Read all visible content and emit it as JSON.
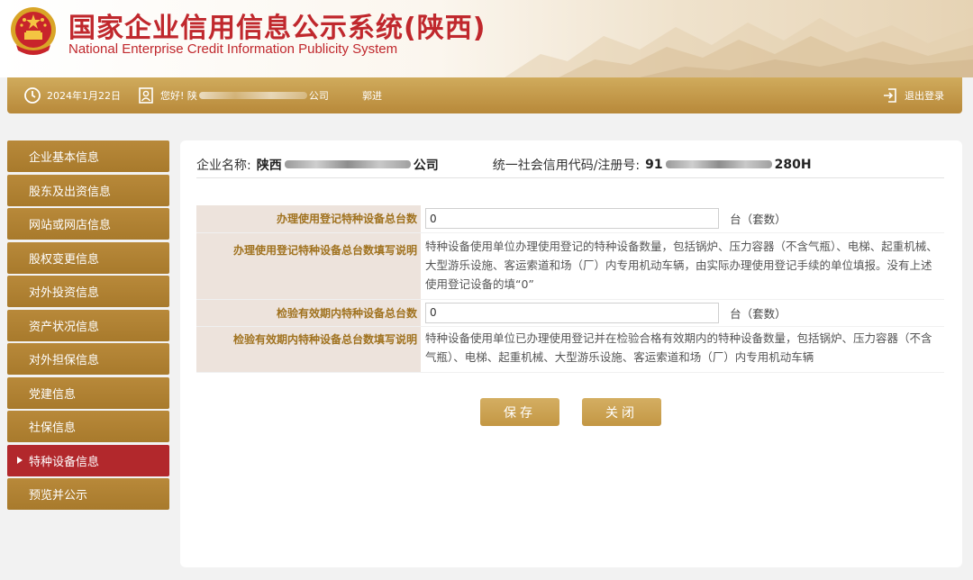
{
  "header": {
    "title_main": "国家企业信用信息公示系统",
    "title_region": "(陕西)",
    "title_en": "National Enterprise Credit Information Publicity System"
  },
  "infobar": {
    "date": "2024年1月22日",
    "greeting_prefix": "您好! 陕",
    "greeting_suffix": "公司",
    "user_name": "郭进",
    "logout_label": "退出登录"
  },
  "sidebar": {
    "items": [
      {
        "label": "企业基本信息"
      },
      {
        "label": "股东及出资信息"
      },
      {
        "label": "网站或网店信息"
      },
      {
        "label": "股权变更信息"
      },
      {
        "label": "对外投资信息"
      },
      {
        "label": "资产状况信息"
      },
      {
        "label": "对外担保信息"
      },
      {
        "label": "党建信息"
      },
      {
        "label": "社保信息"
      },
      {
        "label": "特种设备信息"
      },
      {
        "label": "预览并公示"
      }
    ],
    "active_index": 9
  },
  "company": {
    "name_label": "企业名称:",
    "name_prefix": "陕西",
    "name_suffix": "公司",
    "code_label": "统一社会信用代码/注册号:",
    "code_prefix": "91",
    "code_suffix": "280H"
  },
  "form": {
    "reg_total_label": "办理使用登记特种设备总台数",
    "reg_total_value": "0",
    "reg_total_unit": "台（套数）",
    "reg_note_label": "办理使用登记特种设备总台数填写说明",
    "reg_note_text": "特种设备使用单位办理使用登记的特种设备数量，包括锅炉、压力容器（不含气瓶）、电梯、起重机械、大型游乐设施、客运索道和场（厂）内专用机动车辆，由实际办理使用登记手续的单位填报。没有上述使用登记设备的填“0”",
    "insp_total_label": "检验有效期内特种设备总台数",
    "insp_total_value": "0",
    "insp_total_unit": "台（套数）",
    "insp_note_label": "检验有效期内特种设备总台数填写说明",
    "insp_note_text": "特种设备使用单位已办理使用登记并在检验合格有效期内的特种设备数量，包括锅炉、压力容器（不含气瓶）、电梯、起重机械、大型游乐设施、客运索道和场（厂）内专用机动车辆"
  },
  "buttons": {
    "save_label": "保存",
    "close_label": "关闭"
  }
}
